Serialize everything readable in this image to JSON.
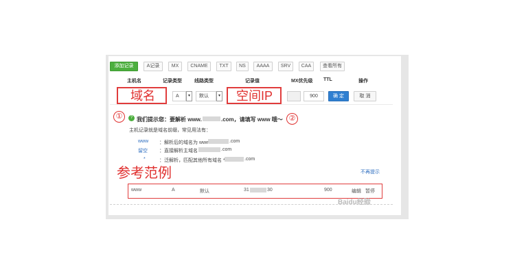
{
  "tabs": {
    "add": "添加记录",
    "items": [
      "A记录",
      "MX",
      "CNAME",
      "TXT",
      "NS",
      "AAAA",
      "SRV",
      "CAA",
      "查看所有"
    ]
  },
  "columns": {
    "host": "主机名",
    "type": "记录类型",
    "line": "线路类型",
    "value": "记录值",
    "mx": "MX优先级",
    "ttl": "TTL",
    "ops": "操作"
  },
  "form": {
    "type_value": "A",
    "line_value": "默认",
    "ttl_value": "900",
    "confirm": "确 定",
    "cancel": "取 消"
  },
  "annotations": {
    "domain_label": "域名",
    "ip_label": "空间IP",
    "circle_1": "①",
    "circle_2": "②",
    "example_label": "参考范例"
  },
  "hint": {
    "title_a": "我们提示您：要解析 www.",
    "title_b": ".com，请填写 www 哦～",
    "subtitle": "主机记录就是域名前缀，常见用法有：",
    "rows": [
      {
        "key": "www",
        "desc": "：解析后的域名为 www.",
        "suffix": ".com"
      },
      {
        "key": "留空",
        "desc": "：直接解析主域名",
        "suffix": ".com"
      },
      {
        "key": "*",
        "desc": "：泛解析，匹配其他所有域名 *.",
        "suffix": ".com"
      }
    ],
    "dismiss": "不再提示"
  },
  "example": {
    "host": "www",
    "type": "A",
    "line": "默认",
    "value_a": "31",
    "value_b": "30",
    "ttl": "900",
    "ops_a": "编辑",
    "ops_b": "暂停"
  },
  "watermark": "Baidu经验",
  "colors": {
    "green": "#4caf3e",
    "blue": "#2f7fd1",
    "red": "#e0302f"
  }
}
